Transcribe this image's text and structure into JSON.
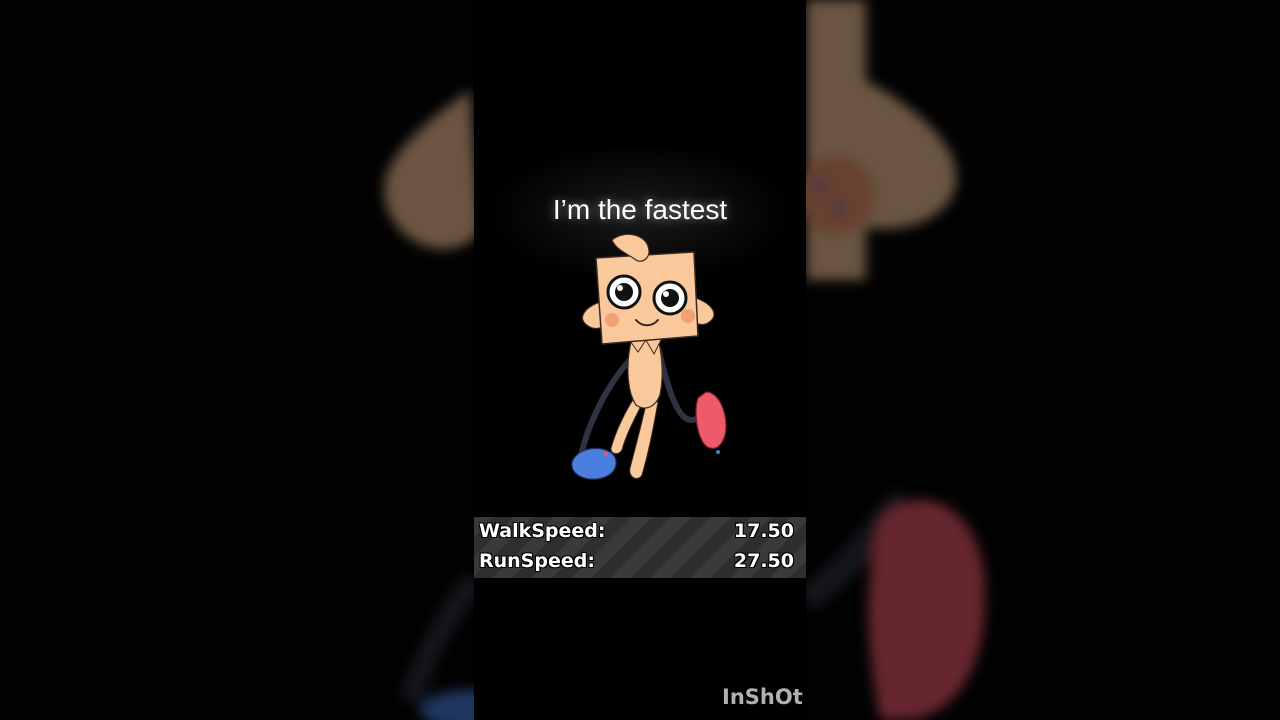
{
  "caption": "I’m the fastest",
  "stats": [
    {
      "label": "WalkSpeed:",
      "value": "17.50"
    },
    {
      "label": "RunSpeed:",
      "value": "27.50"
    }
  ],
  "watermark": "InShOt",
  "colors": {
    "background": "#000000",
    "skin": "#f9c89b",
    "cheek": "#f29a6e",
    "blue_foot": "#4a7fe0",
    "red_foot": "#ef5a6b",
    "limb_dark": "#2d3340",
    "stats_bar": "#3a3a3a"
  }
}
